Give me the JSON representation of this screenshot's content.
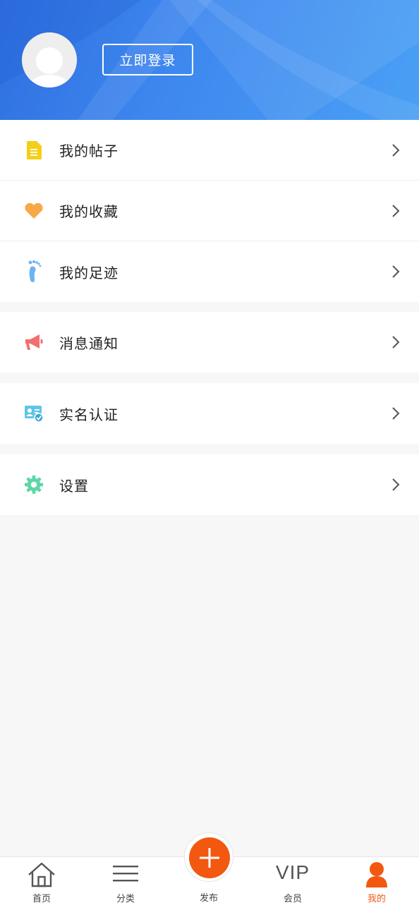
{
  "header": {
    "login_label": "立即登录"
  },
  "menu": {
    "group1": [
      {
        "label": "我的帖子",
        "icon": "document-icon"
      },
      {
        "label": "我的收藏",
        "icon": "heart-icon"
      },
      {
        "label": "我的足迹",
        "icon": "footprint-icon"
      }
    ],
    "group2": [
      {
        "label": "消息通知",
        "icon": "megaphone-icon"
      }
    ],
    "group3": [
      {
        "label": "实名认证",
        "icon": "id-card-icon"
      }
    ],
    "group4": [
      {
        "label": "设置",
        "icon": "gear-icon"
      }
    ]
  },
  "tabbar": {
    "home": "首页",
    "category": "分类",
    "publish": "发布",
    "vip_icon_text": "VIP",
    "vip": "会员",
    "mine": "我的"
  },
  "colors": {
    "accent": "#f2580f",
    "header_blue": "#3d86ee"
  }
}
